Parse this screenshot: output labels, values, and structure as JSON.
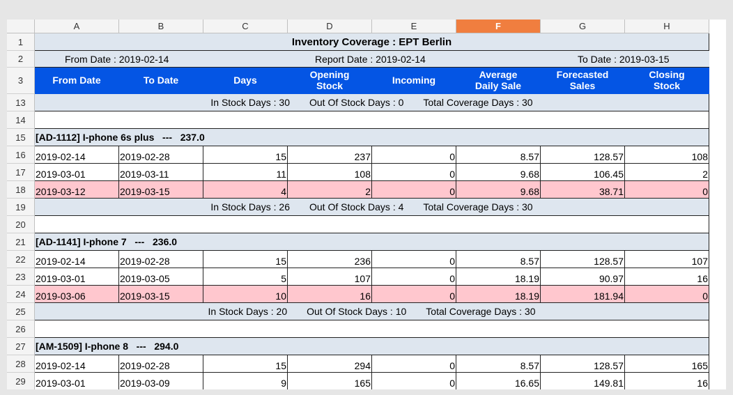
{
  "columns": [
    "A",
    "B",
    "C",
    "D",
    "E",
    "F",
    "G",
    "H"
  ],
  "selected_column": "F",
  "title": "Inventory Coverage : EPT Berlin",
  "row2": {
    "from": "From Date : 2019-02-14",
    "report": "Report Date : 2019-02-14",
    "to": "To Date : 2019-03-15"
  },
  "header": [
    "From Date",
    "To Date",
    "Days",
    "Opening\nStock",
    "Incoming",
    "Average\nDaily Sale",
    "Forecasted\nSales",
    "Closing\nStock"
  ],
  "summary13": {
    "in": "In Stock Days : 30",
    "out": "Out Of Stock Days : 0",
    "total": "Total Coverage Days : 30"
  },
  "products": [
    {
      "row": "15",
      "label": "[AD-1112] I-phone 6s plus   ---   237.0",
      "lines": [
        {
          "row": "16",
          "cells": [
            "2019-02-14",
            "2019-02-28",
            "15",
            "237",
            "0",
            "8.57",
            "128.57",
            "108"
          ],
          "pink": false
        },
        {
          "row": "17",
          "cells": [
            "2019-03-01",
            "2019-03-11",
            "11",
            "108",
            "0",
            "9.68",
            "106.45",
            "2"
          ],
          "pink": false
        },
        {
          "row": "18",
          "cells": [
            "2019-03-12",
            "2019-03-15",
            "4",
            "2",
            "0",
            "9.68",
            "38.71",
            "0"
          ],
          "pink": true
        }
      ],
      "summary_row": "19",
      "summary": {
        "in": "In Stock Days : 26",
        "out": "Out Of Stock Days : 4",
        "total": "Total Coverage Days : 30"
      },
      "blank_row": "20"
    },
    {
      "row": "21",
      "label": "[AD-1141] I-phone 7   ---   236.0",
      "lines": [
        {
          "row": "22",
          "cells": [
            "2019-02-14",
            "2019-02-28",
            "15",
            "236",
            "0",
            "8.57",
            "128.57",
            "107"
          ],
          "pink": false
        },
        {
          "row": "23",
          "cells": [
            "2019-03-01",
            "2019-03-05",
            "5",
            "107",
            "0",
            "18.19",
            "90.97",
            "16"
          ],
          "pink": false
        },
        {
          "row": "24",
          "cells": [
            "2019-03-06",
            "2019-03-15",
            "10",
            "16",
            "0",
            "18.19",
            "181.94",
            "0"
          ],
          "pink": true
        }
      ],
      "summary_row": "25",
      "summary": {
        "in": "In Stock Days : 20",
        "out": "Out Of Stock Days : 10",
        "total": "Total Coverage Days : 30"
      },
      "blank_row": "26"
    },
    {
      "row": "27",
      "label": "[AM-1509] I-phone 8   ---   294.0",
      "lines": [
        {
          "row": "28",
          "cells": [
            "2019-02-14",
            "2019-02-28",
            "15",
            "294",
            "0",
            "8.57",
            "128.57",
            "165"
          ],
          "pink": false
        },
        {
          "row": "29",
          "cells": [
            "2019-03-01",
            "2019-03-09",
            "9",
            "165",
            "0",
            "16.65",
            "149.81",
            "16"
          ],
          "pink": false
        }
      ]
    }
  ]
}
